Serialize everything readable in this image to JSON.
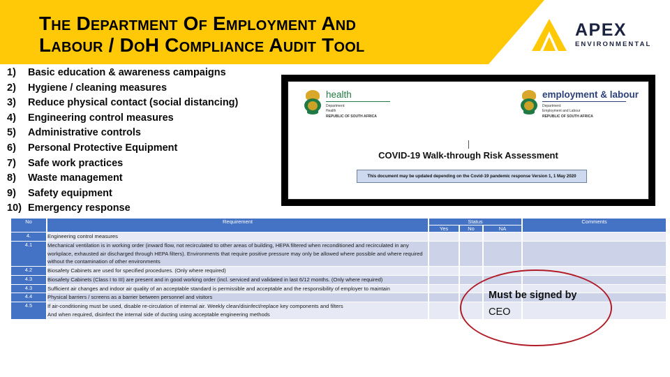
{
  "header": {
    "title_line1": "The Department of Employment and",
    "title_line2": "Labour / DoH Compliance Audit Tool",
    "logo": {
      "name": "APEX",
      "subtitle": "ENVIRONMENTAL",
      "accent": "#FFC907",
      "text_color": "#1c2340"
    }
  },
  "banner_color": "#FFC907",
  "checklist": [
    {
      "num": "1)",
      "label": "Basic education & awareness campaigns"
    },
    {
      "num": "2)",
      "label": "Hygiene / cleaning measures"
    },
    {
      "num": "3)",
      "label": "Reduce physical contact (social distancing)"
    },
    {
      "num": "4)",
      "label": "Engineering control measures"
    },
    {
      "num": "5)",
      "label": "Administrative controls"
    },
    {
      "num": "6)",
      "label": "Personal Protective Equipment"
    },
    {
      "num": "7)",
      "label": "Safe work practices"
    },
    {
      "num": "8)",
      "label": "Waste management"
    },
    {
      "num": "9)",
      "label": "Safety equipment"
    },
    {
      "num": "10)",
      "label": "Emergency response"
    }
  ],
  "document_image": {
    "left_logo": {
      "word": "health",
      "dept_line1": "Department:",
      "dept_line2": "Health",
      "country": "REPUBLIC OF SOUTH AFRICA"
    },
    "right_logo": {
      "word": "employment & labour",
      "dept_line1": "Department:",
      "dept_line2": "Employment and Labour",
      "country": "REPUBLIC OF SOUTH AFRICA"
    },
    "title": "COVID-19 Walk-through Risk Assessment",
    "note": "This document may be updated depending on the Covid-19 pandemic response Version 1, 1 May 2020"
  },
  "table": {
    "headers": {
      "no": "No",
      "requirement": "Requirement",
      "status": "Status",
      "yes": "Yes",
      "no_col": "No",
      "na": "NA",
      "comments": "Comments"
    },
    "rows": [
      {
        "no": "4.",
        "requirement": "Engineering control measures",
        "shade": "A"
      },
      {
        "no": "4.1",
        "requirement": "Mechanical ventilation is in working order (inward flow, not recirculated to other areas of building, HEPA filtered when reconditioned and recirculated in any workplace, exhausted air discharged through HEPA filters). Environments that require positive pressure may only be allowed where possible and where required without the contamination of other environments",
        "shade": "B"
      },
      {
        "no": "4.2",
        "requirement": "Biosafety Cabinets are used for specified procedures. (Only where required)",
        "shade": "A"
      },
      {
        "no": "4.3",
        "requirement": "Biosafety Cabinets (Class I to III) are present and in good working order (incl. serviced and validated in last 6/12 months. (Only where required)",
        "shade": "B"
      },
      {
        "no": "4.3",
        "requirement": "Sufficient air changes and indoor air quality of an acceptable standard is permissible and acceptable and the responsibility of employer to maintain",
        "shade": "A"
      },
      {
        "no": "4.4",
        "requirement": "Physical barriers / screens as a barrier between personnel and visitors",
        "shade": "B"
      },
      {
        "no": "4.5",
        "requirement": "If air-conditioning must be used, disable re-circulation of internal air. Weekly clean/disinfect/replace key components and filters\nAnd when required, disinfect the internal side of ducting using acceptable engineering methods",
        "shade": "A"
      }
    ]
  },
  "annotation": {
    "line1": "Must be signed by",
    "line2": "CEO",
    "ellipse_color": "#b01c28"
  }
}
